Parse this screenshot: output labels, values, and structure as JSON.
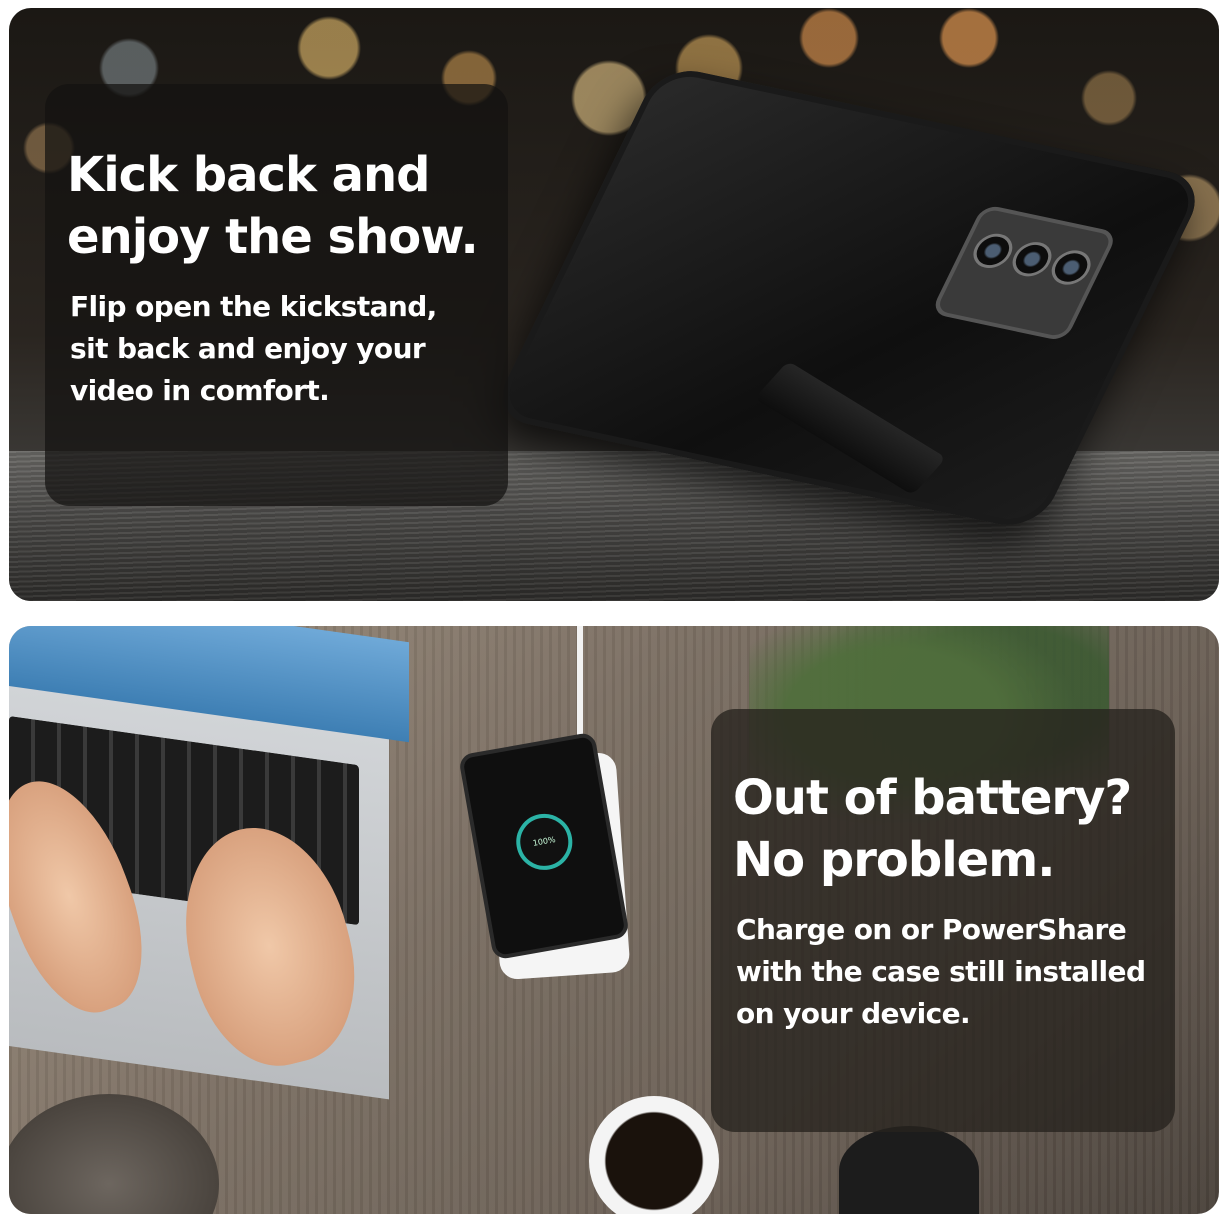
{
  "panels": {
    "top": {
      "headline_line1": "Kick back and",
      "headline_line2": "enjoy the show.",
      "body_line1": "Flip open the kickstand,",
      "body_line2": "sit back and enjoy your",
      "body_line3": "video in comfort."
    },
    "bottom": {
      "headline_line1": "Out of battery?",
      "headline_line2": "No problem.",
      "body_line1": "Charge on or PowerShare",
      "body_line2": "with the case still  installed",
      "body_line3": "on  your device.",
      "phone_screen_text": "100%"
    }
  },
  "colors": {
    "overlay_text": "#ffffff",
    "charge_ring": "#2bb3a6"
  }
}
